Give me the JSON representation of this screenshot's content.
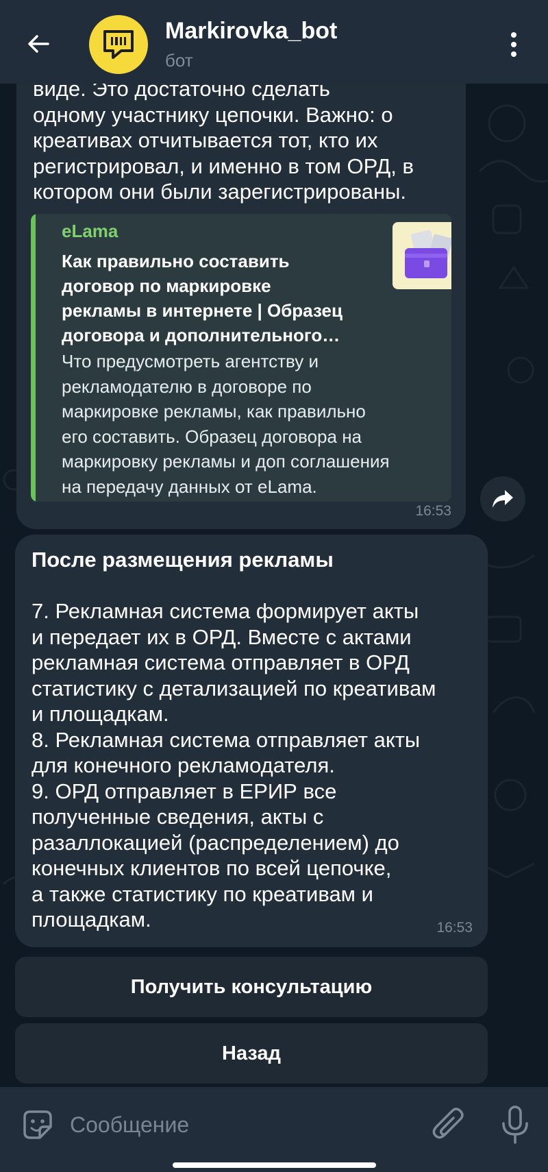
{
  "header": {
    "title": "Markirovka_bot",
    "subtitle": "бот"
  },
  "messages": [
    {
      "lines": [
        "виде. Это достаточно сделать",
        "одному участнику цепочки. Важно: о",
        "креативах отчитывается тот, кто их",
        "регистрировал, и именно в том ОРД, в",
        "котором они были зарегистрированы."
      ],
      "link_preview": {
        "site": "eLama",
        "title_lines": [
          "Как правильно составить",
          "договор по маркировке",
          "рекламы в интернете | Образец",
          "договора и дополнительного…"
        ],
        "desc_lines": [
          "Что предусмотреть агентству и",
          "рекламодателю в договоре по",
          "маркировке рекламы, как правильно",
          "его составить. Образец договора на",
          "маркировку рекламы и доп соглашения",
          "на передачу данных от eLama."
        ]
      },
      "time": "16:53"
    },
    {
      "heading": "После размещения рекламы",
      "lines": [
        "7. Рекламная система формирует акты",
        "и передает их в ОРД. Вместе с актами",
        "рекламная система отправляет в ОРД",
        "статистику с детализацией по креативам",
        "и площадкам.",
        "8. Рекламная система отправляет акты",
        "для конечного рекламодателя.",
        "9. ОРД отправляет в ЕРИР все",
        "полученные сведения, акты с",
        "разаллокацией (распределением) до",
        "конечных клиентов по всей цепочке,",
        "а также статистику по креативам и",
        "площадкам."
      ],
      "time": "16:53"
    }
  ],
  "keyboard": {
    "buttons": [
      "Получить консультацию",
      "Назад"
    ]
  },
  "input": {
    "placeholder": "Сообщение"
  },
  "colors": {
    "header_bg": "#212d3b",
    "bubble_bg": "#222e3a",
    "link_accent": "#6ac35b",
    "avatar_bg": "#f6d93a"
  },
  "icons": {
    "back": "arrow-left-icon",
    "menu": "more-vertical-icon",
    "share": "share-arrow-icon",
    "sticker": "sticker-icon",
    "attach": "paperclip-icon",
    "mic": "microphone-icon"
  }
}
